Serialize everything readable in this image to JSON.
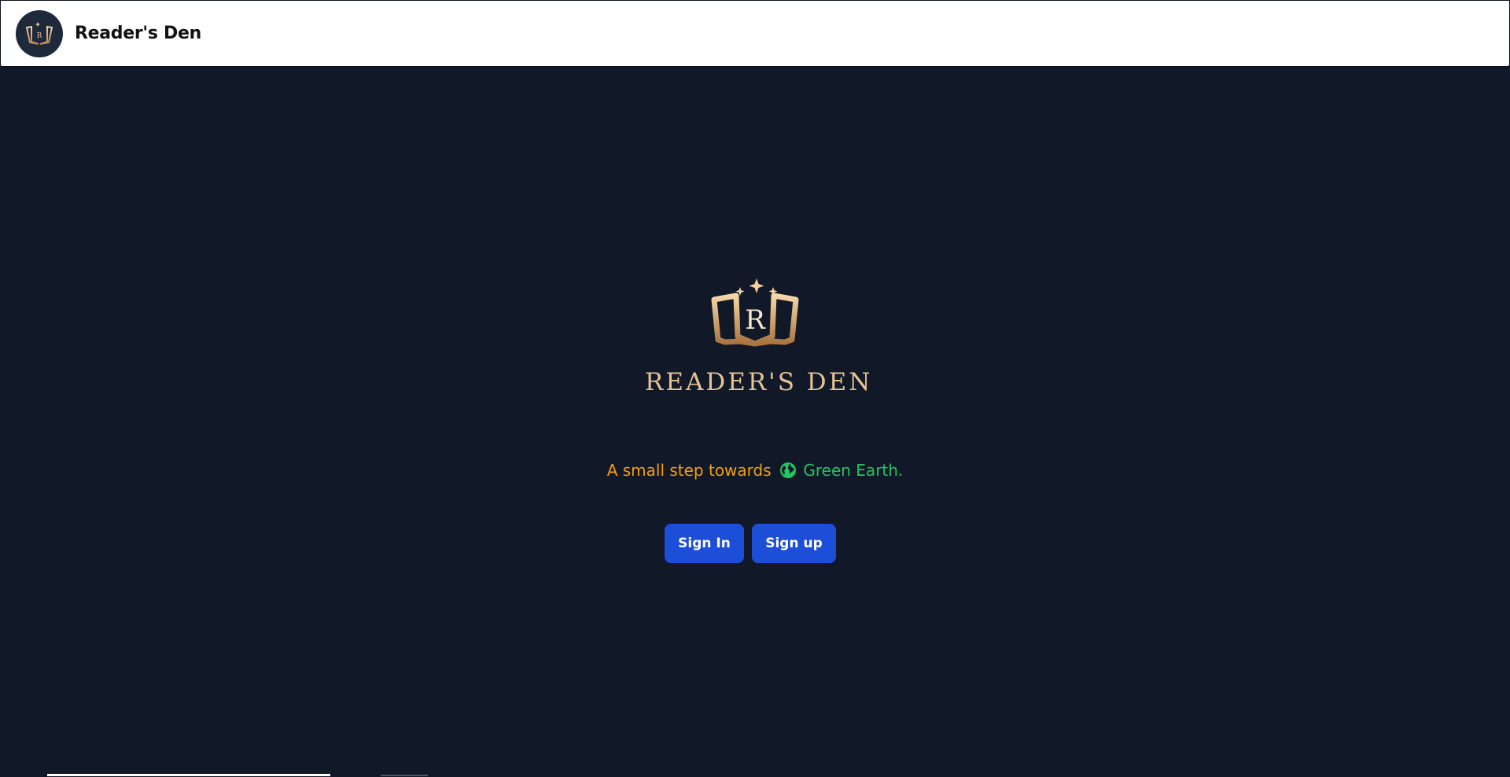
{
  "navbar": {
    "title": "Reader's Den",
    "avatar_letter": "R"
  },
  "hero": {
    "logo_letter": "R",
    "logo_wordmark": "READER'S DEN",
    "tagline_prefix": "A small step towards",
    "tagline_highlight": "Green Earth."
  },
  "actions": {
    "sign_in_label": "Sign In",
    "sign_up_label": "Sign up"
  },
  "colors": {
    "background": "#111827",
    "accent_gold": "#e6c394",
    "tagline_orange": "#f59e0b",
    "tagline_green": "#22c55e",
    "button_blue": "#1d4ed8"
  },
  "icons": {
    "tagline_icon": "globe-icon",
    "logo_icon": "open-book-icon"
  }
}
